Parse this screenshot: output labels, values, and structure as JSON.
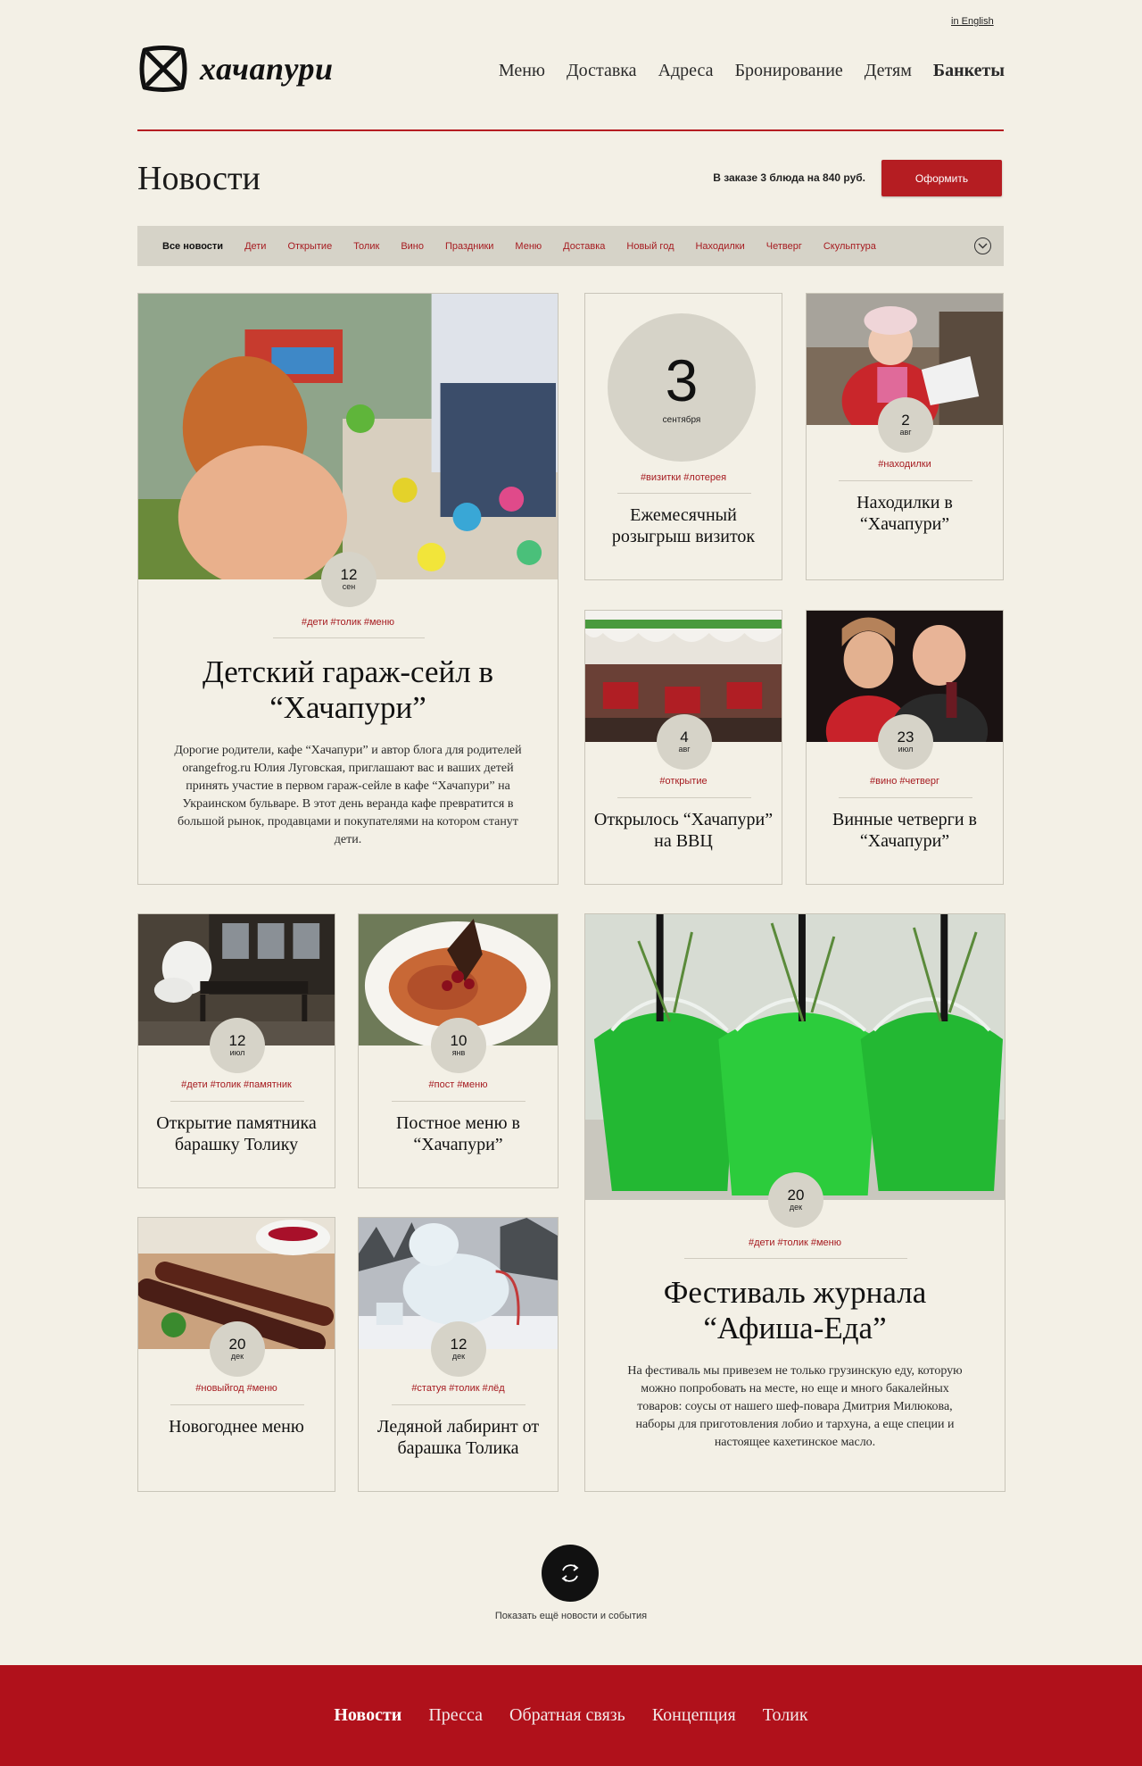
{
  "header": {
    "lang_link": "in English",
    "logo_text": "хачапури",
    "nav": [
      "Меню",
      "Доставка",
      "Адреса",
      "Бронирование",
      "Детям",
      "Банкеты"
    ]
  },
  "page": {
    "title": "Новости",
    "order_text": "В заказе 3 блюда на 840 руб.",
    "order_button": "Оформить"
  },
  "filters": [
    "Все новости",
    "Дети",
    "Открытие",
    "Толик",
    "Вино",
    "Праздники",
    "Меню",
    "Доставка",
    "Новый год",
    "Находилки",
    "Четверг",
    "Скульптура"
  ],
  "cards": [
    {
      "day": "12",
      "month": "сен",
      "tags": "#дети #толик #меню",
      "title": "Детский гараж-сейл в “Хачапури”",
      "text": "Дорогие родители, кафе “Хачапури” и автор блога для родителей orangefrog.ru Юлия Луговская, приглашают вас и ваших детей принять участие в первом гараж-сейле в кафе “Хачапури” на Украинском бульваре. В этот день веранда кафе превратится в большой рынок, продавцами и покупателями на котором станут дети."
    },
    {
      "day": "3",
      "month": "сентября",
      "tags": "#визитки #лотерея",
      "title": "Ежемесячный розыгрыш визиток"
    },
    {
      "day": "2",
      "month": "авг",
      "tags": "#находилки",
      "title": "Находилки в “Хачапури”"
    },
    {
      "day": "4",
      "month": "авг",
      "tags": "#открытие",
      "title": "Открылось “Хачапури” на ВВЦ"
    },
    {
      "day": "23",
      "month": "июл",
      "tags": "#вино #четверг",
      "title": "Винные четверги в “Хачапури”"
    },
    {
      "day": "12",
      "month": "июл",
      "tags": "#дети #толик #памятник",
      "title": "Открытие памятника барашку Толику"
    },
    {
      "day": "10",
      "month": "янв",
      "tags": "#пост #меню",
      "title": "Постное меню в “Хачапури”"
    },
    {
      "day": "20",
      "month": "дек",
      "tags": "#дети #толик #меню",
      "title": "Фестиваль журнала “Афиша-Еда”",
      "text": "На фестиваль мы привезем не только грузинскую еду, которую можно попробовать на месте, но еще и много бакалейных товаров: соусы от нашего шеф-повара Дмитрия Милюкова, наборы для приготовления лобио и тархуна, а еще специи и настоящее кахетинское масло."
    },
    {
      "day": "20",
      "month": "дек",
      "tags": "#новыйгод #меню",
      "title": "Новогоднее меню"
    },
    {
      "day": "12",
      "month": "дек",
      "tags": "#статуя #толик #лёд",
      "title": "Ледяной лабиринт от барашка Толика"
    }
  ],
  "more": {
    "label": "Показать ещё новости и события"
  },
  "footer": {
    "links": [
      "Новости",
      "Пресса",
      "Обратная связь",
      "Концепция",
      "Толик"
    ]
  },
  "colors": {
    "accent": "#b51d22",
    "background": "#f3f0e6",
    "badge": "#d6d3c8",
    "footer": "#b0111b"
  },
  "icons": [
    "logo-icon",
    "chevron-down-icon",
    "refresh-icon"
  ]
}
